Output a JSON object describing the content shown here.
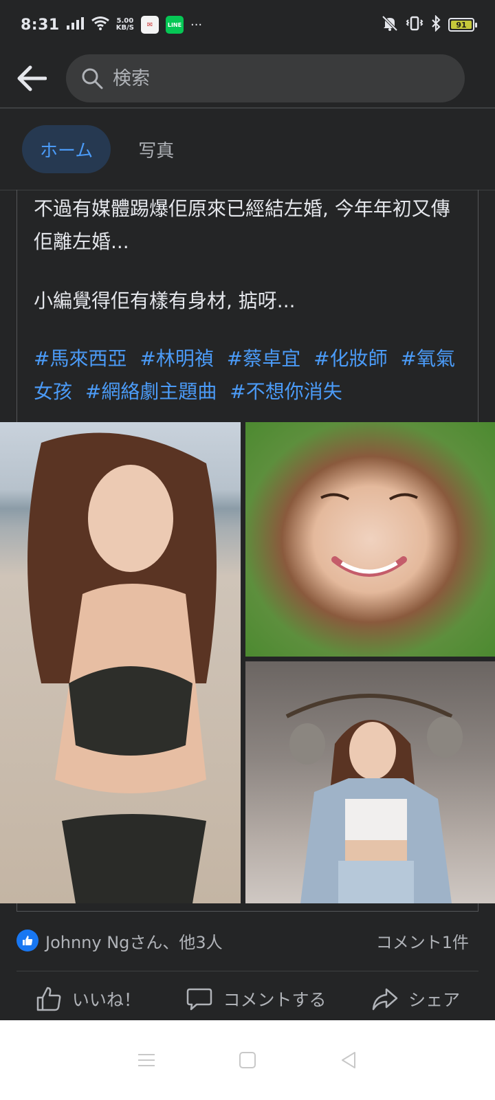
{
  "status_bar": {
    "time": "8:31",
    "speed_value": "5.00",
    "speed_unit": "KB/S",
    "line_label": "LINE",
    "more": "···",
    "battery": "91",
    "battery_level": 0.91
  },
  "search": {
    "placeholder": "検索"
  },
  "tabs": [
    {
      "label": "ホーム",
      "active": true
    },
    {
      "label": "写真",
      "active": false
    }
  ],
  "post": {
    "paragraph1": "不過有媒體踢爆佢原來已經結左婚, 今年年初又傳佢離左婚...",
    "paragraph2": "小編覺得佢有樣有身材, 掂呀...",
    "hashtags": [
      "#馬來西亞",
      "#林明禎",
      "#蔡卓宜",
      "#化妝師",
      "#氧氣女孩",
      "#網絡劇主題曲",
      "#不想你消失"
    ]
  },
  "reactions": {
    "text": "Johnny Ngさん、他3人",
    "comments": "コメント1件"
  },
  "actions": {
    "like": "いいね！",
    "comment": "コメントする",
    "share": "シェア"
  },
  "colors": {
    "background": "#242526",
    "accent": "#4b9bf7",
    "like_blue": "#1877f2"
  }
}
